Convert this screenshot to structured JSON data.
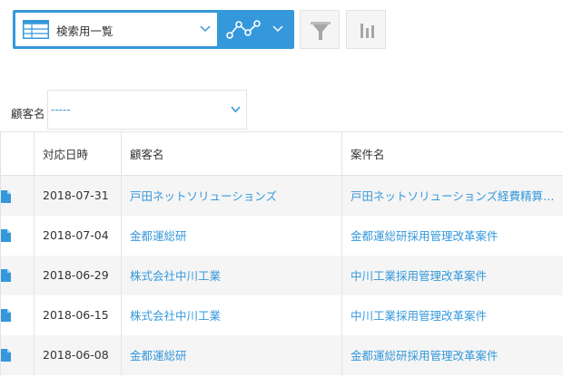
{
  "toolbar": {
    "view_label": "検索用一覧",
    "view_icon": "table-icon",
    "graph_icon": "line-graph-icon",
    "filter_icon": "filter-icon",
    "chart_icon": "bar-chart-icon",
    "accent_color": "#3498db"
  },
  "filter": {
    "label": "顧客名",
    "selected": "-----"
  },
  "table": {
    "columns": [
      "対応日時",
      "顧客名",
      "案件名"
    ],
    "rows": [
      {
        "date": "2018-07-31",
        "customer": "戸田ネットソリューションズ",
        "project": "戸田ネットソリューションズ経費精算システム導入"
      },
      {
        "date": "2018-07-04",
        "customer": "金都運総研",
        "project": "金都運総研採用管理改革案件"
      },
      {
        "date": "2018-06-29",
        "customer": "株式会社中川工業",
        "project": "中川工業採用管理改革案件"
      },
      {
        "date": "2018-06-15",
        "customer": "株式会社中川工業",
        "project": "中川工業採用管理改革案件"
      },
      {
        "date": "2018-06-08",
        "customer": "金都運総研",
        "project": "金都運総研採用管理改革案件"
      }
    ]
  }
}
